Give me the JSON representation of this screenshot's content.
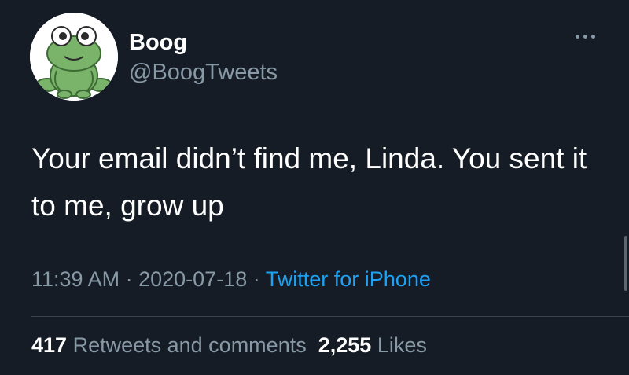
{
  "author": {
    "display_name": "Boog",
    "handle": "@BoogTweets"
  },
  "tweet": {
    "text": "Your email didn’t find me, Linda. You sent it to me, grow up",
    "time": "11:39 AM",
    "date": "2020-07-18",
    "separator": "·",
    "source": "Twitter for iPhone"
  },
  "stats": {
    "retweets_count": "417",
    "retweets_label": "Retweets and comments",
    "likes_count": "2,255",
    "likes_label": "Likes"
  },
  "icons": {
    "avatar": "frog-avatar-icon",
    "more": "more-options-icon"
  },
  "colors": {
    "background": "#151c26",
    "text_primary": "#ffffff",
    "text_secondary": "#8899a6",
    "link": "#1da1f2",
    "divider": "#38444d"
  }
}
